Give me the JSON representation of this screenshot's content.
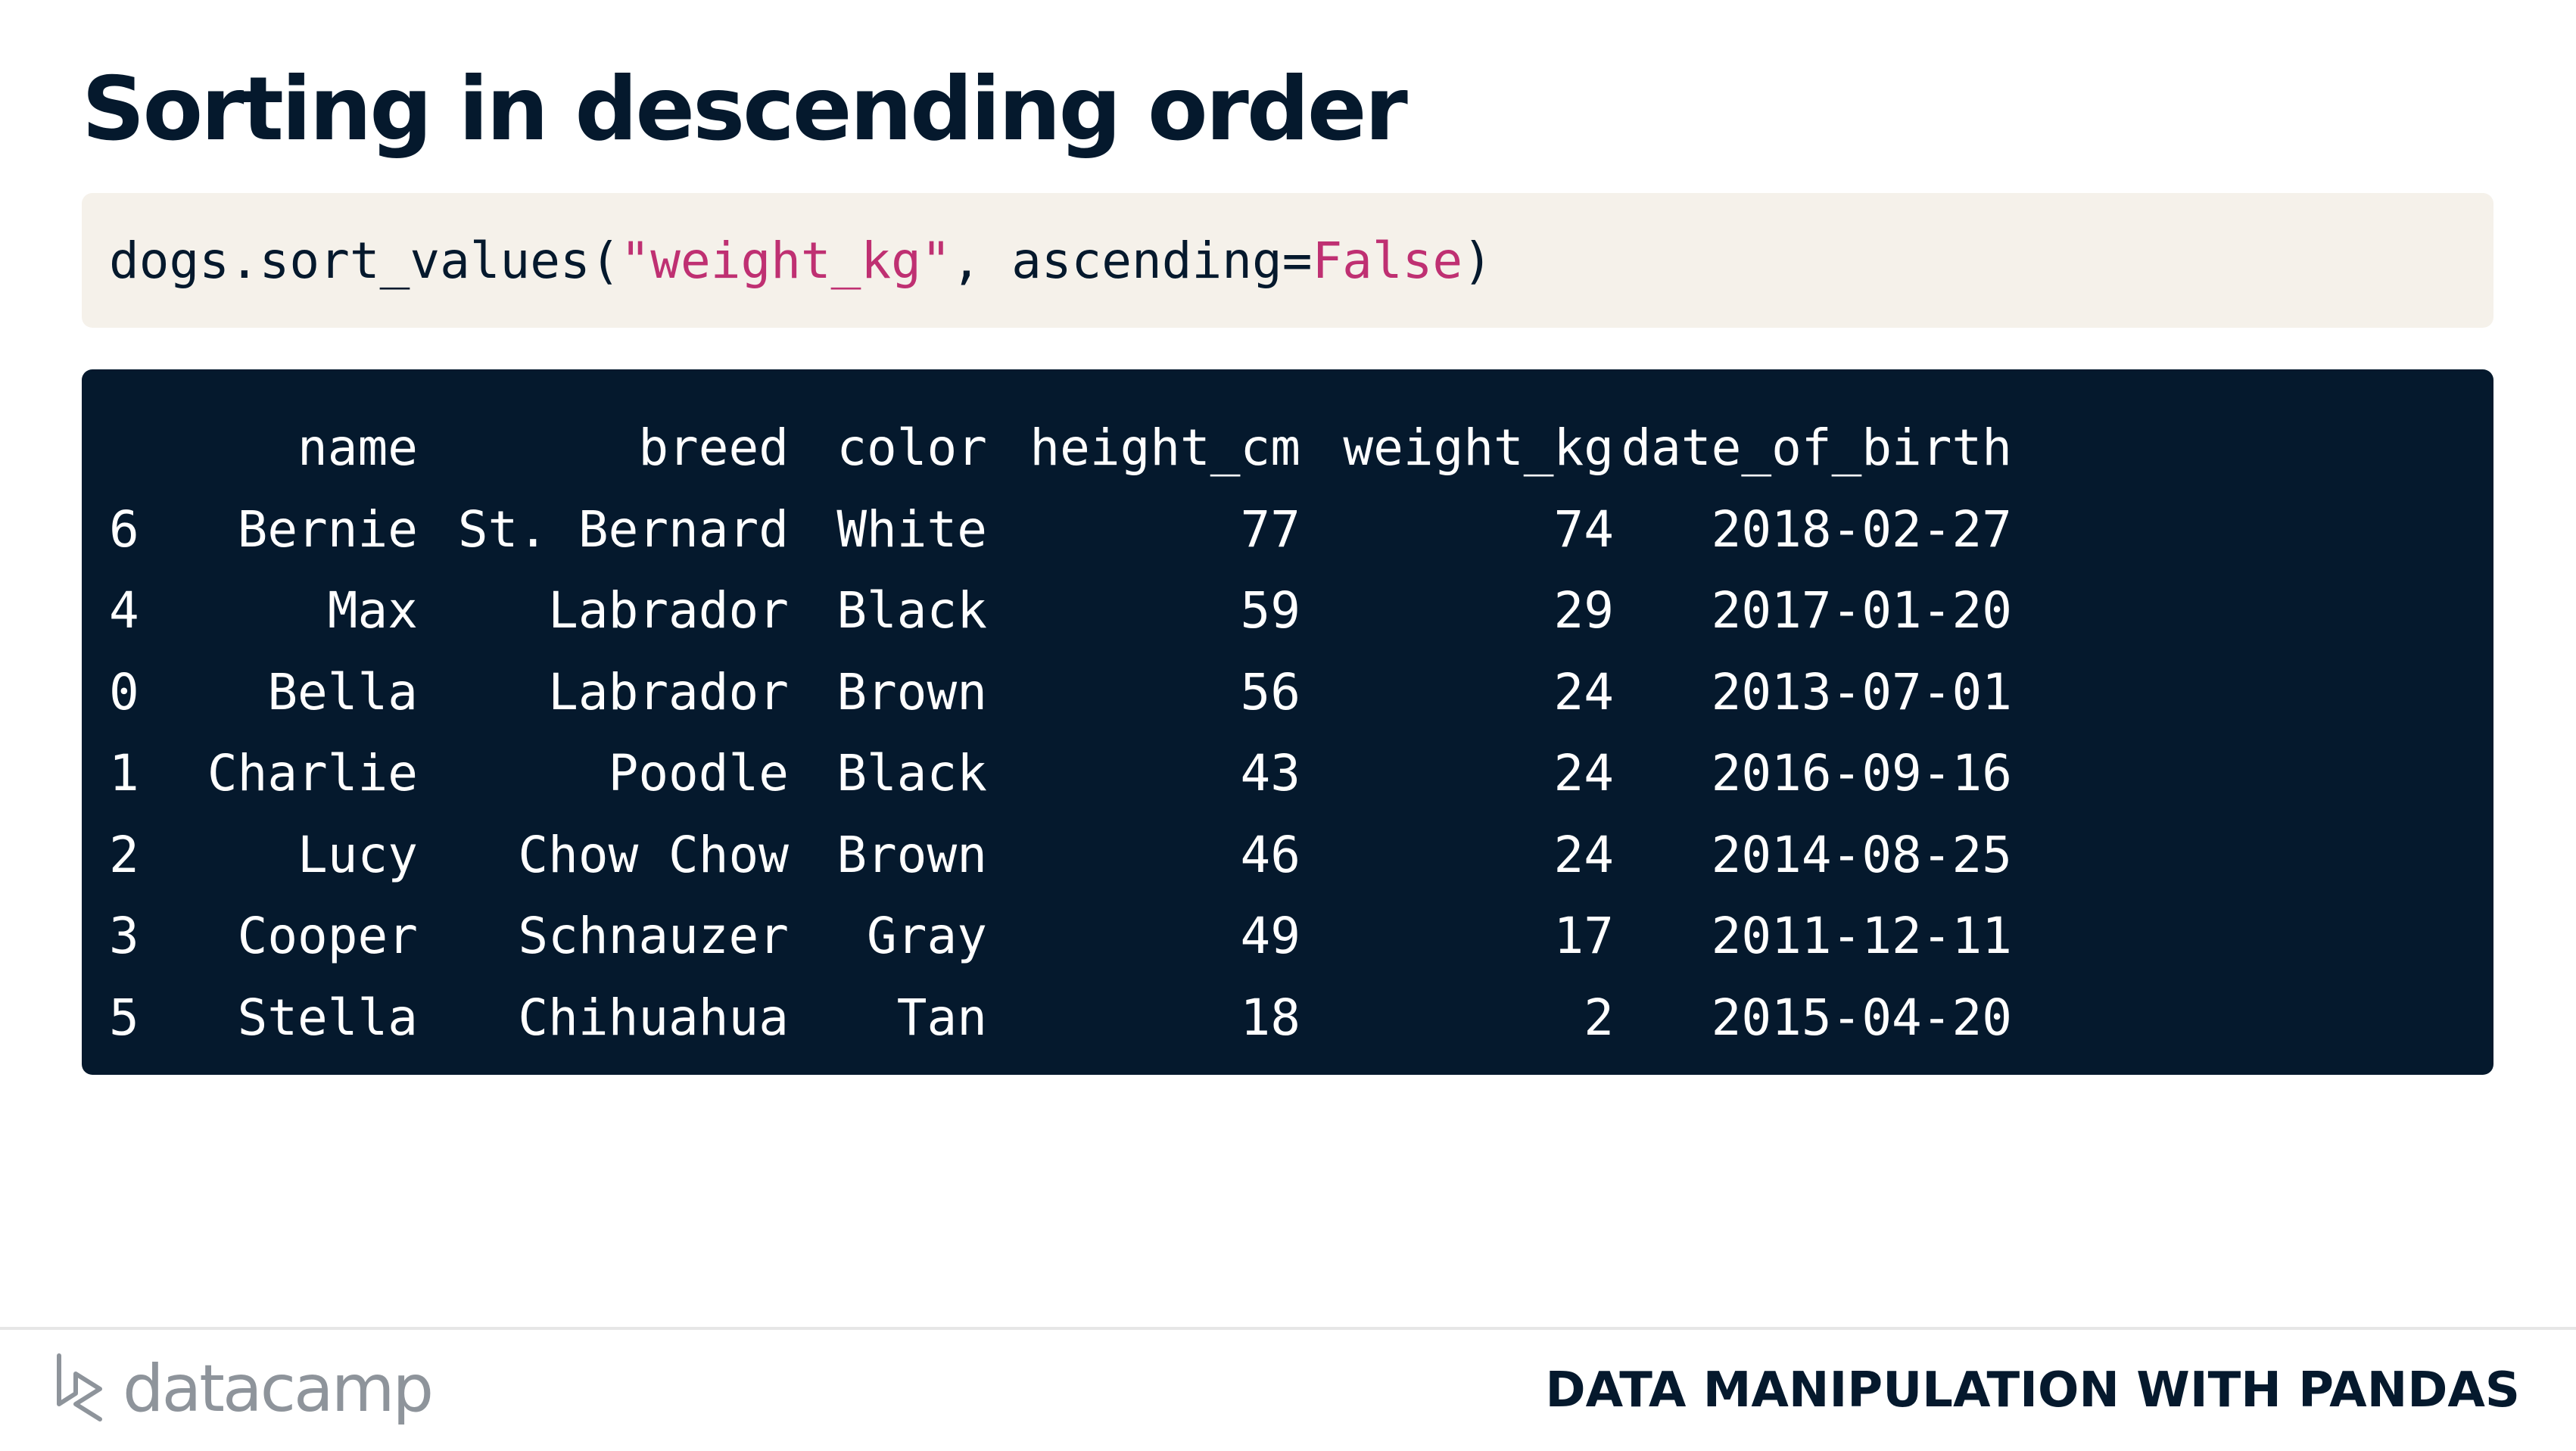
{
  "slide": {
    "title": "Sorting in descending order"
  },
  "code": {
    "prefix": "dogs.sort_values(",
    "string_arg": "\"weight_kg\"",
    "middle": ", ascending=",
    "keyword": "False",
    "suffix": ")"
  },
  "table": {
    "columns": [
      "",
      "name",
      "breed",
      "color",
      "height_cm",
      "weight_kg",
      "date_of_birth"
    ],
    "rows": [
      [
        "6",
        "Bernie",
        "St. Bernard",
        "White",
        "77",
        "74",
        "2018-02-27"
      ],
      [
        "4",
        "Max",
        "Labrador",
        "Black",
        "59",
        "29",
        "2017-01-20"
      ],
      [
        "0",
        "Bella",
        "Labrador",
        "Brown",
        "56",
        "24",
        "2013-07-01"
      ],
      [
        "1",
        "Charlie",
        "Poodle",
        "Black",
        "43",
        "24",
        "2016-09-16"
      ],
      [
        "2",
        "Lucy",
        "Chow Chow",
        "Brown",
        "46",
        "24",
        "2014-08-25"
      ],
      [
        "3",
        "Cooper",
        "Schnauzer",
        "Gray",
        "49",
        "17",
        "2011-12-11"
      ],
      [
        "5",
        "Stella",
        "Chihuahua",
        "Tan",
        "18",
        "2",
        "2015-04-20"
      ]
    ]
  },
  "footer": {
    "logo_text": "datacamp",
    "logo_icon": "datacamp-logo-icon",
    "course_title": "DATA MANIPULATION WITH PANDAS"
  },
  "colors": {
    "navy": "#05192d",
    "code_bg": "#f5f1ea",
    "string": "#bf3072",
    "logo_gray": "#8e949b"
  }
}
